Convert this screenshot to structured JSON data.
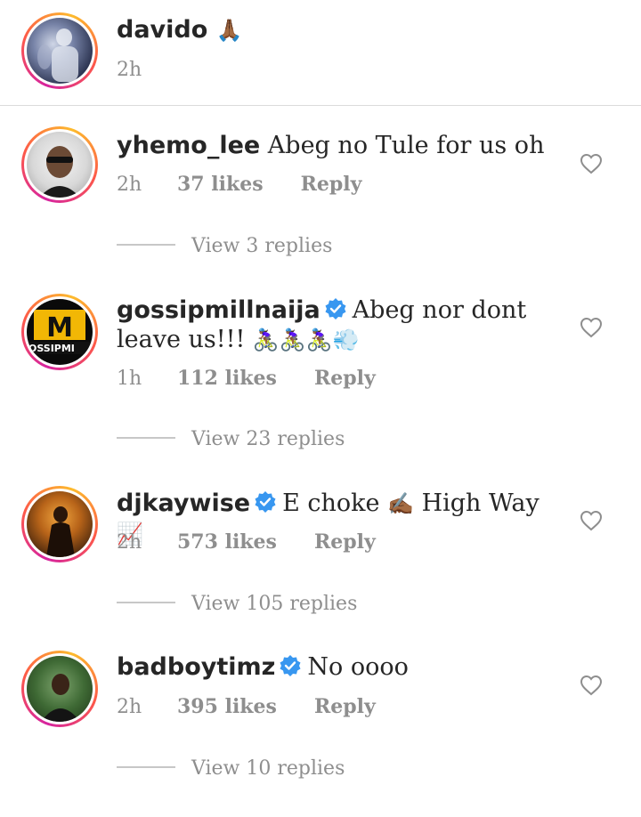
{
  "post": {
    "username": "davido",
    "emoji": "🙏🏾",
    "time": "2h"
  },
  "comments": [
    {
      "username": "yhemo_lee",
      "verified": false,
      "text": "Abeg no Tule for us oh",
      "time": "2h",
      "likes": "37 likes",
      "reply": "Reply",
      "view_replies": "View 3 replies"
    },
    {
      "username": "gossipmillnaija",
      "verified": true,
      "text": "Abeg nor dont leave us!!!",
      "emoji": "🚴🏾‍♀️🚴🏾‍♀️🚴🏾‍♀️💨",
      "time": "1h",
      "likes": "112 likes",
      "reply": "Reply",
      "view_replies": "View 23 replies"
    },
    {
      "username": "djkaywise",
      "verified": true,
      "text": "E choke",
      "emoji1": "✍🏾",
      "text2": "High Way",
      "emoji2": "📈",
      "time": "2h",
      "likes": "573 likes",
      "reply": "Reply",
      "view_replies": "View 105 replies"
    },
    {
      "username": "badboytimz",
      "verified": true,
      "text": "No oooo",
      "time": "2h",
      "likes": "395 likes",
      "reply": "Reply",
      "view_replies": "View 10 replies"
    }
  ],
  "colors": {
    "text": "#262626",
    "muted": "#8e8e8e",
    "verified": "#3897f0",
    "divider": "#dbdbdb"
  },
  "icons": {
    "like": "heart-outline-icon",
    "verified": "verified-badge-icon"
  }
}
